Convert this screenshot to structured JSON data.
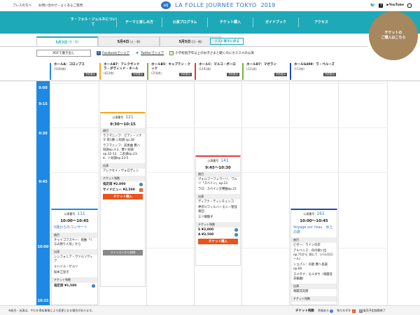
{
  "topbar": {
    "links": [
      "プレスの方へ",
      "お問い合わせ・よくあるご質問"
    ],
    "logo_badge": "LFJ",
    "logo_text": "LA FOLLE JOURNÉE TOKYO",
    "logo_year": "2019",
    "social": [
      "twitter-icon",
      "facebook-icon",
      "youtube-icon",
      "instagram-icon"
    ]
  },
  "nav": {
    "items": [
      "ラ・フォル・ジュルネについて",
      "テーマと楽しみ方",
      "公演プログラム",
      "チケット購入",
      "ガイドブック",
      "アクセス"
    ],
    "ticket_circle": "チケットの\nご購入はこちら"
  },
  "date_tabs": [
    {
      "date": "5月3日",
      "day": "(金・祝)",
      "active": true
    },
    {
      "date": "5月4日",
      "day": "(土・祝)",
      "active": false
    },
    {
      "date": "5月5日",
      "day": "(日・祝)",
      "active": false
    }
  ],
  "list_button": "リスト表示に戻る",
  "share": {
    "pdf": "PDFで書き出し",
    "facebook": "Facebookでシェア",
    "twitter": "Twitterでシェア",
    "kids_label": "子",
    "kids": "小学校低学年以上のお子さまと聴くのにオススメの公演"
  },
  "halls": [
    {
      "name": "ホールA：コロンブス",
      "cap": "(5008席)",
      "color": "#1e88e5",
      "reserve": "予約表示"
    },
    {
      "name": "ホールB7：アレクサンドラ・ダヴィッド・ネール",
      "cap": "(822席)",
      "color": "#f5a623",
      "reserve": "予約表示"
    },
    {
      "name": "ホールB5：キャプテン・クック",
      "cap": "(256席)",
      "color": "#7cb342",
      "reserve": "予約表示"
    },
    {
      "name": "ホールC：マルコ・ポーロ",
      "cap": "(1492席)",
      "color": "#e53935",
      "reserve": "予約表示"
    },
    {
      "name": "ホールD7：マゼラン",
      "cap": "(221席)",
      "color": "#7cb342",
      "reserve": "予約表示"
    },
    {
      "name": "ホールG409：ラ・ペルーズ",
      "cap": "(153席)",
      "color": "#1e4fa3",
      "reserve": "予約表示"
    }
  ],
  "times": [
    "9:00",
    "9:15",
    "9:30",
    "9:45",
    "10:00",
    "10:15"
  ],
  "events": [
    {
      "label": "公演番号",
      "num": "121",
      "time": "9:30〜10:15",
      "sec_song": "曲目",
      "songs": [
        "ラフマニノフ：ピアノ・ソナタ 第1番 ニ短調 op.28",
        "ラフマニノフ：前奏曲 嬰ハ短調op.3-2、嬰ト短調op.32-12、二長調op.23-4、ト短調op.23-5"
      ],
      "sec_perf": "出演",
      "performers": [
        "アレクセイ・ヴォロディン"
      ],
      "sec_ticket": "チケット残数",
      "prices": [
        {
          "label": "指定席 ¥2,800",
          "mark": "○"
        },
        {
          "label": "サイドビュー ¥2,500",
          "mark": "△"
        }
      ],
      "buy": "チケット購入",
      "mylist": "マイリストから削除"
    },
    {
      "label": "公演番号",
      "num": "141",
      "time": "9:45〜10:30",
      "sec_song": "曲目",
      "songs": [
        "ヴォルフ＝フェラーリ：ワルツ「スペイン」op.23",
        "ラロ：スペイン交響曲op.21"
      ],
      "sec_perf": "出演",
      "performers": [
        "ディアナ・ティシチェンコ",
        "神奈川フィルハーモニー管弦楽団",
        "三ツ橋敬子"
      ],
      "sec_ticket": "チケット残数",
      "prices": [
        {
          "label": "S ¥3,000",
          "mark": "○"
        },
        {
          "label": "A ¥2,500",
          "mark": "○"
        }
      ],
      "buy": "チケット購入"
    },
    {
      "label": "公演番号",
      "num": "111",
      "time": "10:00〜10:45",
      "title": "0歳からのコンサート",
      "sec_song": "曲目",
      "songs": [
        "チャイコフスキー：組曲「くるみ割り人形」から"
      ],
      "sec_perf": "出演",
      "performers": [
        "シンフォニア・ヴァルソヴィア",
        "ミハイル・ゲルツ",
        "坂本江里子"
      ],
      "sec_ticket": "チケット残数",
      "prices": [
        {
          "label": "指定席 ¥1,500",
          "mark": "○"
        }
      ]
    },
    {
      "label": "公演番号",
      "num": "161",
      "time": "10:00〜10:45",
      "title": "Voyage sur l'eau　水上の旅",
      "sec_song": "曲目",
      "songs": [
        "ビゼー：ラインの岸",
        "アルベニス：舟の歌い出op.71から 海にて（バルカロール）",
        "ショパン：舟歌 嬰ヘ長調 op.60",
        "スメタナ：モルダウ（喚聞流夫編曲）"
      ],
      "sec_perf": "出演",
      "performers": [
        "喚聞流夫朗"
      ],
      "sec_ticket": "チケット残数"
    }
  ],
  "bottom": {
    "note": "※曲目・出演は、やむを得ぬ事情により変更となる場合があります。",
    "legend_title": "チケット残数",
    "legend": [
      {
        "label": "余裕あり",
        "mark": "○"
      },
      {
        "label": "残りわずか",
        "mark": "△"
      },
      {
        "label": "販売予定枚数終了",
        "mark": "×"
      }
    ]
  }
}
